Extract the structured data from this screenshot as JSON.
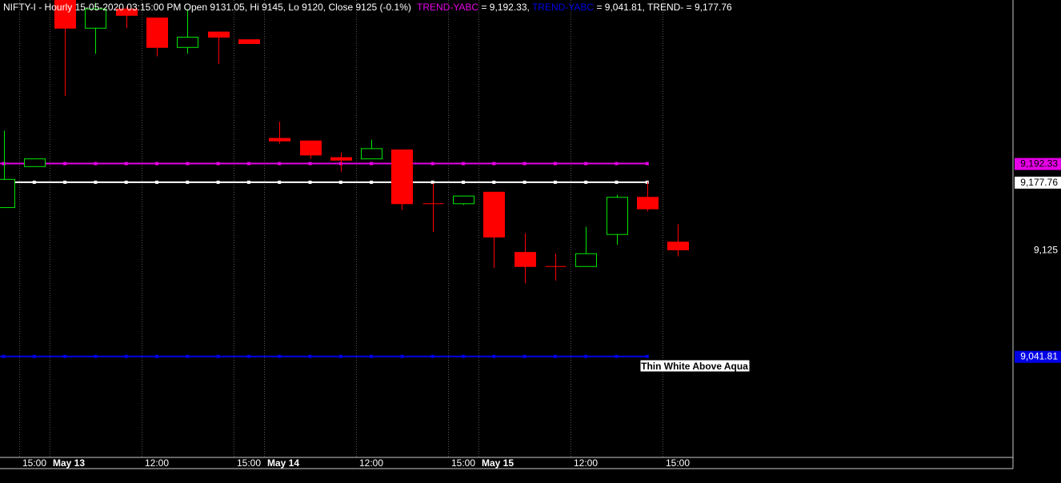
{
  "header": {
    "symbol_info": "NIFTY-I - Hourly 15-05-2020 03:15:00 PM Open 9131.05, Hi 9145, Lo 9120, Close 9125 (-0.1%)",
    "trend_yabc_upper_label": "TREND-YABC",
    "trend_yabc_upper_value": " = 9,192.33, ",
    "trend_yabc_lower_label": "TREND-YABC",
    "trend_yabc_lower_value": " = 9,041.81, ",
    "trend_minus_label": "TREND-",
    "trend_minus_value": " = 9,177.76"
  },
  "annotation": {
    "text": "Thin White Above Aqua"
  },
  "price_axis": {
    "labels": [
      {
        "text": "9,192.33",
        "value": 9192.33,
        "bg": "#e600e6",
        "fg": "#000000"
      },
      {
        "text": "9,177.76",
        "value": 9177.76,
        "bg": "#ffffff",
        "fg": "#000000"
      },
      {
        "text": "9,125",
        "value": 9125,
        "bg": "none",
        "fg": "#ffffff"
      },
      {
        "text": "9,041.81",
        "value": 9041.81,
        "bg": "#0000e6",
        "fg": "#ffffff"
      }
    ]
  },
  "time_axis": {
    "labels": [
      {
        "text": "15:00",
        "bar": 0.5,
        "bold": false
      },
      {
        "text": "May 13",
        "bar": 1.5,
        "bold": true
      },
      {
        "text": "12:00",
        "bar": 4.5,
        "bold": false
      },
      {
        "text": "15:00",
        "bar": 7.5,
        "bold": false
      },
      {
        "text": "May 14",
        "bar": 8.5,
        "bold": true
      },
      {
        "text": "12:00",
        "bar": 11.5,
        "bold": false
      },
      {
        "text": "15:00",
        "bar": 14.5,
        "bold": false
      },
      {
        "text": "May 15",
        "bar": 15.5,
        "bold": true
      },
      {
        "text": "12:00",
        "bar": 18.5,
        "bold": false
      },
      {
        "text": "15:00",
        "bar": 21.5,
        "bold": false
      }
    ]
  },
  "chart_data": {
    "type": "candlestick",
    "symbol": "NIFTY-I",
    "interval": "Hourly",
    "ylim": [
      8963,
      9320
    ],
    "candles": [
      {
        "o": 9158,
        "h": 9218,
        "l": 9158,
        "c": 9180
      },
      {
        "o": 9190,
        "h": 9190,
        "l": 9190,
        "c": 9196
      },
      {
        "o": 9335,
        "h": 9335,
        "l": 9245,
        "c": 9298
      },
      {
        "o": 9298,
        "h": 9318,
        "l": 9278,
        "c": 9313
      },
      {
        "o": 9313,
        "h": 9315,
        "l": 9298,
        "c": 9308
      },
      {
        "o": 9306,
        "h": 9306,
        "l": 9276,
        "c": 9283
      },
      {
        "o": 9283,
        "h": 9313,
        "l": 9278,
        "c": 9291
      },
      {
        "o": 9295,
        "h": 9295,
        "l": 9270,
        "c": 9291
      },
      {
        "o": 9289,
        "h": 9289,
        "l": 9286,
        "c": 9286
      },
      {
        "o": 9212,
        "h": 9225,
        "l": 9208,
        "c": 9210
      },
      {
        "o": 9210,
        "h": 9210,
        "l": 9196,
        "c": 9199
      },
      {
        "o": 9197,
        "h": 9201,
        "l": 9186,
        "c": 9195
      },
      {
        "o": 9196,
        "h": 9211,
        "l": 9196,
        "c": 9204
      },
      {
        "o": 9203,
        "h": 9203,
        "l": 9156,
        "c": 9161
      },
      {
        "o": 9161,
        "h": 9177,
        "l": 9139,
        "c": 9161
      },
      {
        "o": 9161,
        "h": 9167,
        "l": 9160,
        "c": 9167
      },
      {
        "o": 9170,
        "h": 9170,
        "l": 9111,
        "c": 9135
      },
      {
        "o": 9123,
        "h": 9138,
        "l": 9099,
        "c": 9112
      },
      {
        "o": 9112,
        "h": 9122,
        "l": 9101,
        "c": 9112
      },
      {
        "o": 9112,
        "h": 9143,
        "l": 9112,
        "c": 9122
      },
      {
        "o": 9137,
        "h": 9168,
        "l": 9129,
        "c": 9166
      },
      {
        "o": 9166,
        "h": 9178,
        "l": 9155,
        "c": 9157
      },
      {
        "o": 9131.05,
        "h": 9145,
        "l": 9120,
        "c": 9125
      }
    ],
    "lines": [
      {
        "name": "TREND-YABC",
        "value": 9192.33,
        "color": "#e600e6",
        "from_bar": 0,
        "to_bar": 21
      },
      {
        "name": "TREND-",
        "value": 9177.76,
        "color": "#ffffff",
        "from_bar": 0,
        "to_bar": 21
      },
      {
        "name": "TREND-YABC",
        "value": 9041.81,
        "color": "#0000e6",
        "from_bar": 0,
        "to_bar": 21
      }
    ],
    "colors": {
      "up": "#00e600",
      "down": "#ff0000",
      "grid": "#555555",
      "background": "#000000"
    }
  }
}
